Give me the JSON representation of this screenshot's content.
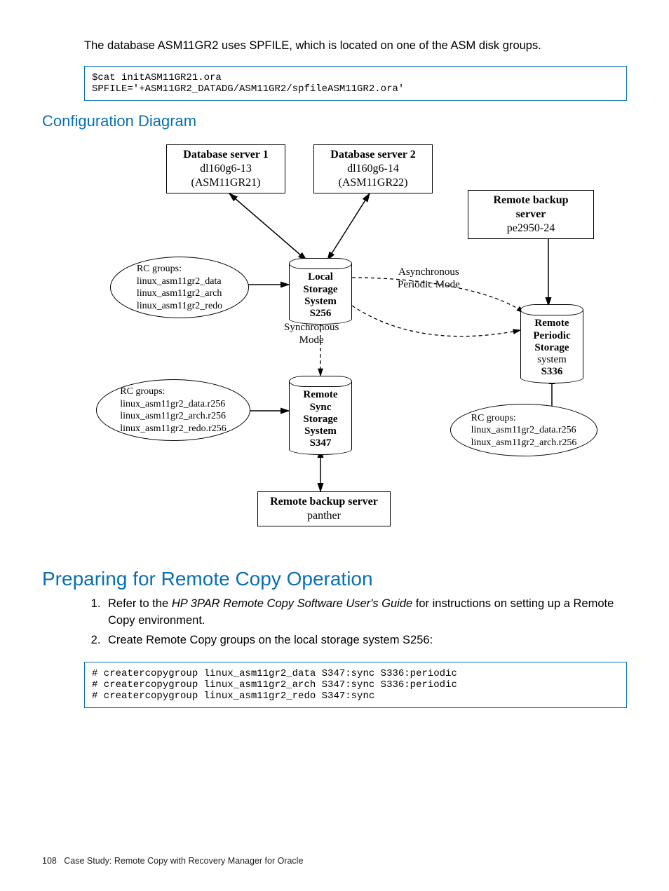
{
  "intro_text": "The database ASM11GR2 uses SPFILE, which is located on one of the ASM disk groups.",
  "code1": "$cat initASM11GR21.ora\nSPFILE='+ASM11GR2_DATADG/ASM11GR2/spfileASM11GR2.ora'",
  "h2_config": "Configuration Diagram",
  "diagram": {
    "db1_title": "Database server 1",
    "db1_l1": "dl160g6-13",
    "db1_l2": "(ASM11GR21)",
    "db2_title": "Database server 2",
    "db2_l1": "dl160g6-14",
    "db2_l2": "(ASM11GR22)",
    "rbs1_title": "Remote backup server",
    "rbs1_l1": "pe2950-24",
    "rbs2_title": "Remote backup server",
    "rbs2_l1": "panther",
    "local_l1": "Local",
    "local_l2": "Storage",
    "local_l3": "System",
    "local_l4": "S256",
    "rsync_l1": "Remote",
    "rsync_l2": "Sync",
    "rsync_l3": "Storage",
    "rsync_l4": "System",
    "rsync_l5": "S347",
    "rper_l1": "Remote",
    "rper_l2": "Periodic",
    "rper_l3": "Storage",
    "rper_l4": "system",
    "rper_l5": "S336",
    "rc1_title": "RC groups:",
    "rc1_l1": "linux_asm11gr2_data",
    "rc1_l2": "linux_asm11gr2_arch",
    "rc1_l3": "linux_asm11gr2_redo",
    "rc2_title": "RC groups:",
    "rc2_l1": "linux_asm11gr2_data.r256",
    "rc2_l2": "linux_asm11gr2_arch.r256",
    "rc2_l3": "linux_asm11gr2_redo.r256",
    "rc3_title": "RC groups:",
    "rc3_l1": "linux_asm11gr2_data.r256",
    "rc3_l2": "linux_asm11gr2_arch.r256",
    "async_label": "Asynchronous\nPeriodic Mode",
    "sync_label": "Synchronous\nMode"
  },
  "h1_prep": "Preparing for Remote Copy Operation",
  "step1_pre": "Refer to the ",
  "step1_italic": "HP 3PAR Remote Copy Software User's Guide",
  "step1_post": " for instructions on setting up a Remote Copy environment.",
  "step2": "Create Remote Copy groups on the local storage system S256:",
  "code2": "# creatercopygroup linux_asm11gr2_data S347:sync S336:periodic\n# creatercopygroup linux_asm11gr2_arch S347:sync S336:periodic\n# creatercopygroup linux_asm11gr2_redo S347:sync",
  "footer_page": "108",
  "footer_text": "Case Study: Remote Copy with Recovery Manager for Oracle"
}
